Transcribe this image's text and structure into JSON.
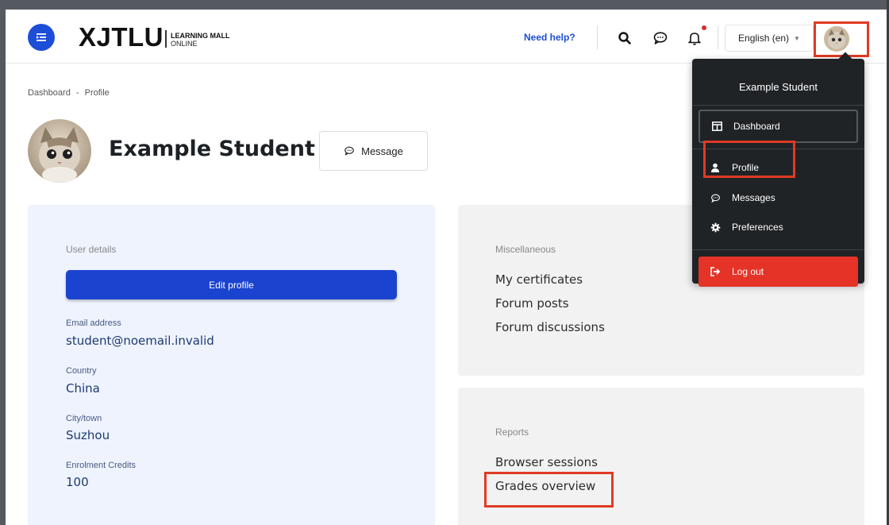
{
  "navbar": {
    "logo_main": "XJTLU",
    "logo_sub_1": "LEARNING MALL",
    "logo_sub_2": "ONLINE",
    "need_help": "Need help?",
    "language": "English (en)"
  },
  "breadcrumb": {
    "dashboard": "Dashboard",
    "separator": "-",
    "current": "Profile"
  },
  "profile": {
    "name": "Example Student",
    "message_button": "Message"
  },
  "user_details": {
    "heading": "User details",
    "edit_button": "Edit profile",
    "fields": [
      {
        "label": "Email address",
        "value": "student@noemail.invalid"
      },
      {
        "label": "Country",
        "value": "China"
      },
      {
        "label": "City/town",
        "value": "Suzhou"
      },
      {
        "label": "Enrolment Credits",
        "value": "100"
      }
    ]
  },
  "miscellaneous": {
    "heading": "Miscellaneous",
    "links": [
      "My certificates",
      "Forum posts",
      "Forum discussions"
    ]
  },
  "reports": {
    "heading": "Reports",
    "links": [
      "Browser sessions",
      "Grades overview"
    ]
  },
  "user_menu": {
    "name": "Example Student",
    "items": [
      "Dashboard",
      "Profile",
      "Messages",
      "Preferences"
    ],
    "logout": "Log out"
  },
  "colors": {
    "brand_blue": "#1a43cf",
    "highlight_red": "#e03a24",
    "dropdown_bg": "#202326",
    "logout_red": "#e53427"
  },
  "icons": {
    "drawer": "menu-drawer-icon",
    "search": "search-icon",
    "messages": "chat-bubble-icon",
    "notifications": "bell-icon"
  }
}
